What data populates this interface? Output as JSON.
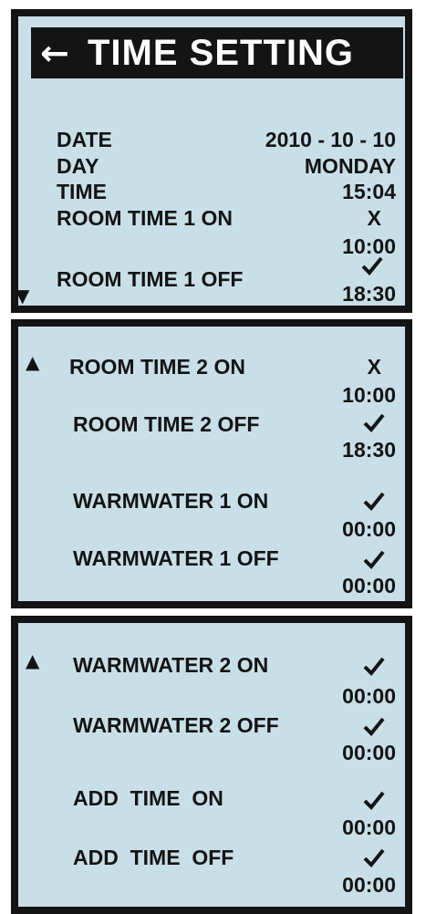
{
  "header": {
    "back_icon": "left-arrow-icon",
    "title": "TIME SETTING"
  },
  "screen1": {
    "date_label": "DATE",
    "date_value": "2010 - 10 - 10",
    "day_label": "DAY",
    "day_value": "MONDAY",
    "time_label": "TIME",
    "time_value": "15:04",
    "room1_on_label": "ROOM TIME 1 ON",
    "room1_on_state": "X",
    "room1_on_time": "10:00",
    "room1_off_label": "ROOM TIME 1 OFF",
    "room1_off_state": "checkmark-icon",
    "room1_off_time": "18:30",
    "scroll_down_icon": "down-triangle-icon"
  },
  "screen2": {
    "scroll_up_icon": "up-triangle-icon",
    "room2_on_label": "ROOM TIME 2 ON",
    "room2_on_state": "X",
    "room2_on_time": "10:00",
    "room2_off_label": "ROOM TIME 2 OFF",
    "room2_off_state": "checkmark-icon",
    "room2_off_time": "18:30",
    "ww1_on_label": "WARMWATER 1 ON",
    "ww1_on_state": "checkmark-icon",
    "ww1_on_time": "00:00",
    "ww1_off_label": "WARMWATER 1 OFF",
    "ww1_off_state": "checkmark-icon",
    "ww1_off_time": "00:00"
  },
  "screen3": {
    "scroll_up_icon": "up-triangle-icon",
    "ww2_on_label": "WARMWATER 2 ON",
    "ww2_on_state": "checkmark-icon",
    "ww2_on_time": "00:00",
    "ww2_off_label": "WARMWATER 2 OFF",
    "ww2_off_state": "checkmark-icon",
    "ww2_off_time": "00:00",
    "add_on_label": "ADD  TIME  ON",
    "add_on_state": "checkmark-icon",
    "add_on_time": "00:00",
    "add_off_label": "ADD  TIME  OFF",
    "add_off_state": "checkmark-icon",
    "add_off_time": "00:00"
  },
  "colors": {
    "screen_bg": "#c9dfe8",
    "frame": "#141414",
    "text": "#141414",
    "title_text": "#ffffff"
  }
}
